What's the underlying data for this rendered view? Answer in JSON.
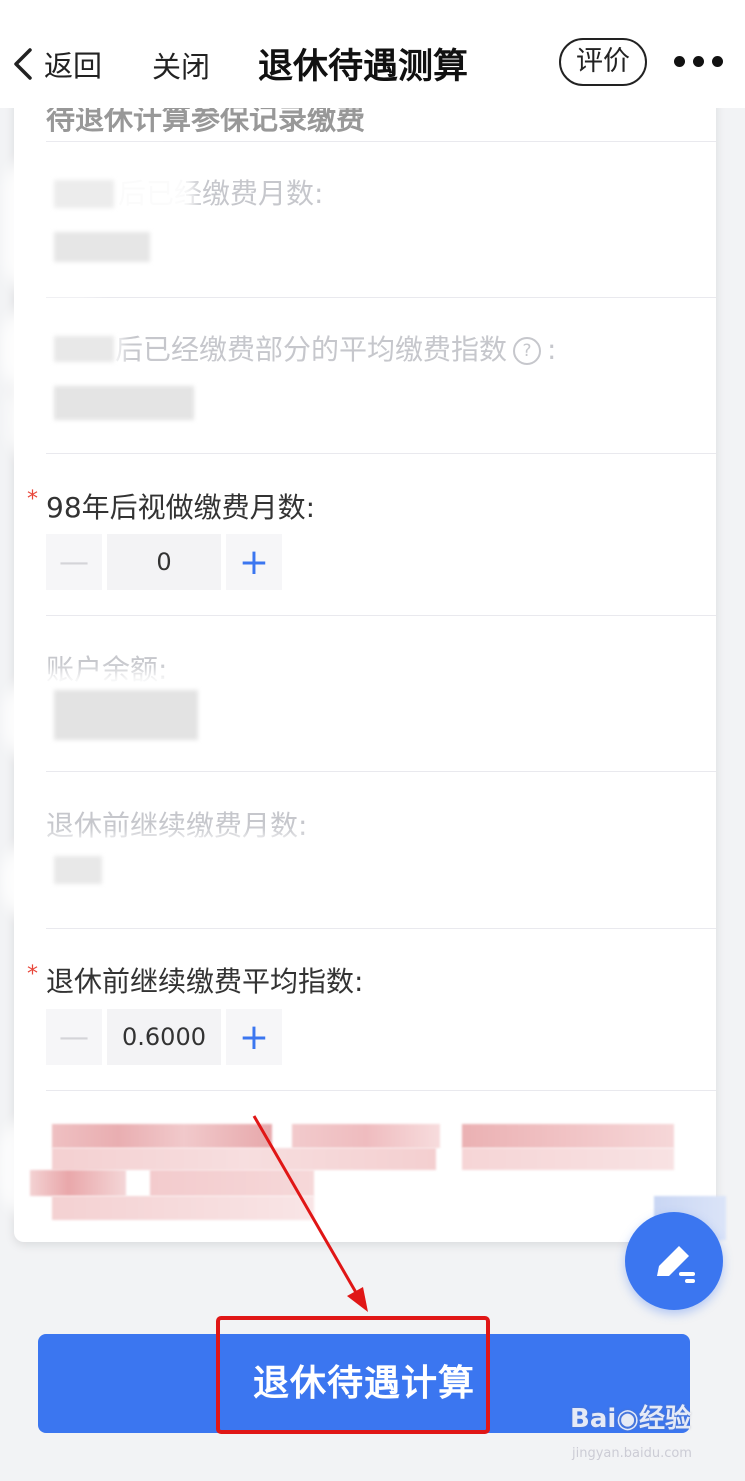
{
  "nav": {
    "back_label": "返回",
    "close_label": "关闭",
    "title": "退休待遇测算",
    "rate_label": "评价"
  },
  "form": {
    "cut_heading": "待退休计算参保记录缴费",
    "field_months_paid": "后已经缴费月数:",
    "field_avg_index": "后已经缴费部分的平均缴费指数",
    "field_avg_index_colon": ":",
    "help_icon_text": "?",
    "field_deemed_months": "98年后视做缴费月数:",
    "deemed_months_value": "0",
    "field_balance": "账户余额:",
    "field_continue_months": "退休前继续缴费月数:",
    "field_continue_index": "退休前继续缴费平均指数:",
    "continue_index_value": "0.6000",
    "required_mark": "*"
  },
  "main_button_label": "退休待遇计算",
  "watermark": {
    "logo": "Bai◉经验",
    "url": "jingyan.baidu.com"
  },
  "colors": {
    "accent": "#3b76f0",
    "required": "#e8463a",
    "highlight": "#e01616"
  }
}
